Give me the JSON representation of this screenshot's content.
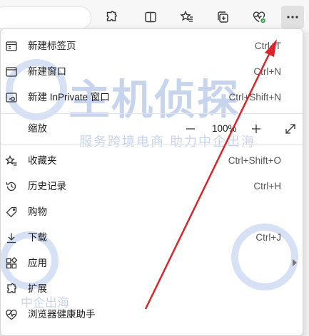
{
  "toolbar": {
    "buttons": [
      {
        "name": "extensions-icon"
      },
      {
        "name": "split-screen-icon"
      },
      {
        "name": "favorites-icon"
      },
      {
        "name": "collections-icon"
      },
      {
        "name": "browser-essentials-icon"
      },
      {
        "name": "more-icon"
      }
    ]
  },
  "menu": {
    "new_tab": {
      "label": "新建标签页",
      "shortcut": "Ctrl+T"
    },
    "new_window": {
      "label": "新建窗口",
      "shortcut": "Ctrl+N"
    },
    "new_inprivate": {
      "label": "新建 InPrivate 窗口",
      "shortcut": "Ctrl+Shift+N"
    },
    "zoom": {
      "label": "缩放",
      "minus": "—",
      "value": "100%",
      "plus": "+"
    },
    "favorites": {
      "label": "收藏夹",
      "shortcut": "Ctrl+Shift+O"
    },
    "history": {
      "label": "历史记录",
      "shortcut": "Ctrl+H"
    },
    "shopping": {
      "label": "购物"
    },
    "downloads": {
      "label": "下载",
      "shortcut": "Ctrl+J"
    },
    "apps": {
      "label": "应用"
    },
    "extensions": {
      "label": "扩展"
    },
    "browser_essentials": {
      "label": "浏览器健康助手"
    }
  },
  "watermark": {
    "main": "主机侦探",
    "sub": "服务跨境电商 助力中企出海",
    "corner": "中企出海"
  },
  "colors": {
    "accent_arrow": "#d9262b",
    "watermark": "#8fb0e0",
    "health_badge": "#2e9f3e"
  }
}
